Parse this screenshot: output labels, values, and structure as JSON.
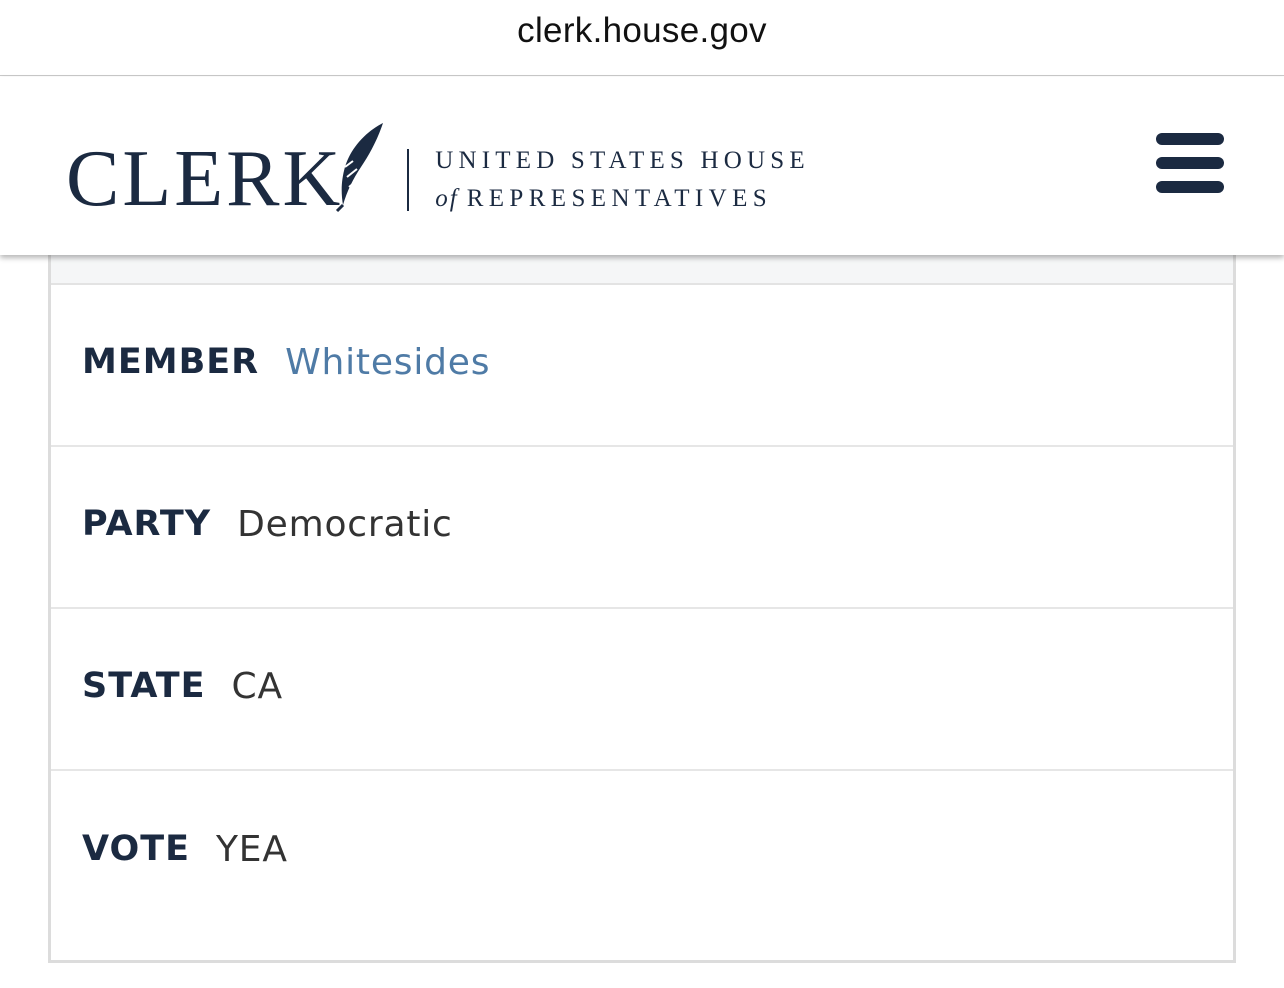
{
  "browser": {
    "url": "clerk.house.gov"
  },
  "header": {
    "logo_word": "CLERK",
    "logo_line1": "UNITED STATES HOUSE",
    "logo_line2_prefix": "of",
    "logo_line2": "REPRESENTATIVES",
    "menu_icon": "hamburger-menu-icon"
  },
  "record": {
    "rows": [
      {
        "label": "MEMBER",
        "value": "Whitesides"
      },
      {
        "label": "PARTY",
        "value": "Democratic"
      },
      {
        "label": "STATE",
        "value": "CA"
      },
      {
        "label": "VOTE",
        "value": "YEA"
      }
    ]
  },
  "colors": {
    "navy": "#1b2a41",
    "link": "#4f7ba6",
    "text": "#333333",
    "border": "#dcdcdc"
  }
}
